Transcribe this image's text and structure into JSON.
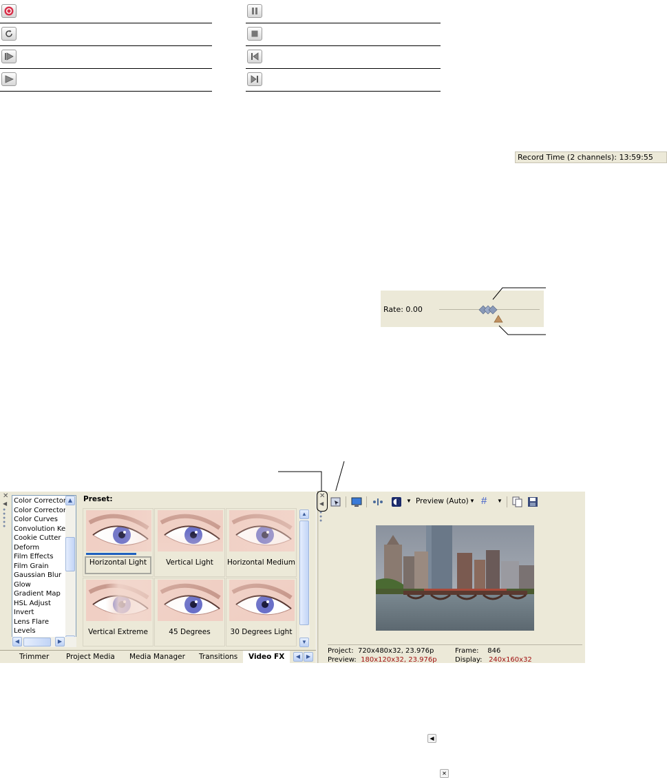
{
  "transport": {
    "left": [
      "record-icon",
      "loop-icon",
      "play-from-start-icon",
      "play-icon"
    ],
    "right": [
      "pause-icon",
      "stop-icon",
      "go-to-start-icon",
      "go-to-end-icon"
    ]
  },
  "record_time": "Record Time (2 channels): 13:59:55",
  "rate": {
    "label": "Rate: 0.00"
  },
  "fx": {
    "items": [
      "Color Corrector",
      "Color Corrector",
      "Color Curves",
      "Convolution Kern",
      "Cookie Cutter",
      "Deform",
      "Film Effects",
      "Film Grain",
      "Gaussian Blur",
      "Glow",
      "Gradient Map",
      "HSL Adjust",
      "Invert",
      "Lens Flare",
      "Levels"
    ],
    "preset_label": "Preset:",
    "presets": [
      "Horizontal Light",
      "Vertical Light",
      "Horizontal Medium",
      "Vertical Extreme",
      "45 Degrees",
      "30 Degrees Light"
    ]
  },
  "tabs": [
    "Trimmer",
    "Project Media",
    "Media Manager",
    "Transitions",
    "Video FX"
  ],
  "preview": {
    "mode": "Preview (Auto)",
    "project_label": "Project:",
    "project_value": "720x480x32, 23.976p",
    "preview_label": "Preview:",
    "preview_value": "180x120x32, 23.976p",
    "frame_label": "Frame:",
    "frame_value": "846",
    "display_label": "Display:",
    "display_value": "240x160x32"
  },
  "colors": {
    "panel": "#ece9d8",
    "accent_blue": "#1f5fbf",
    "stat_red": "#a01010"
  }
}
